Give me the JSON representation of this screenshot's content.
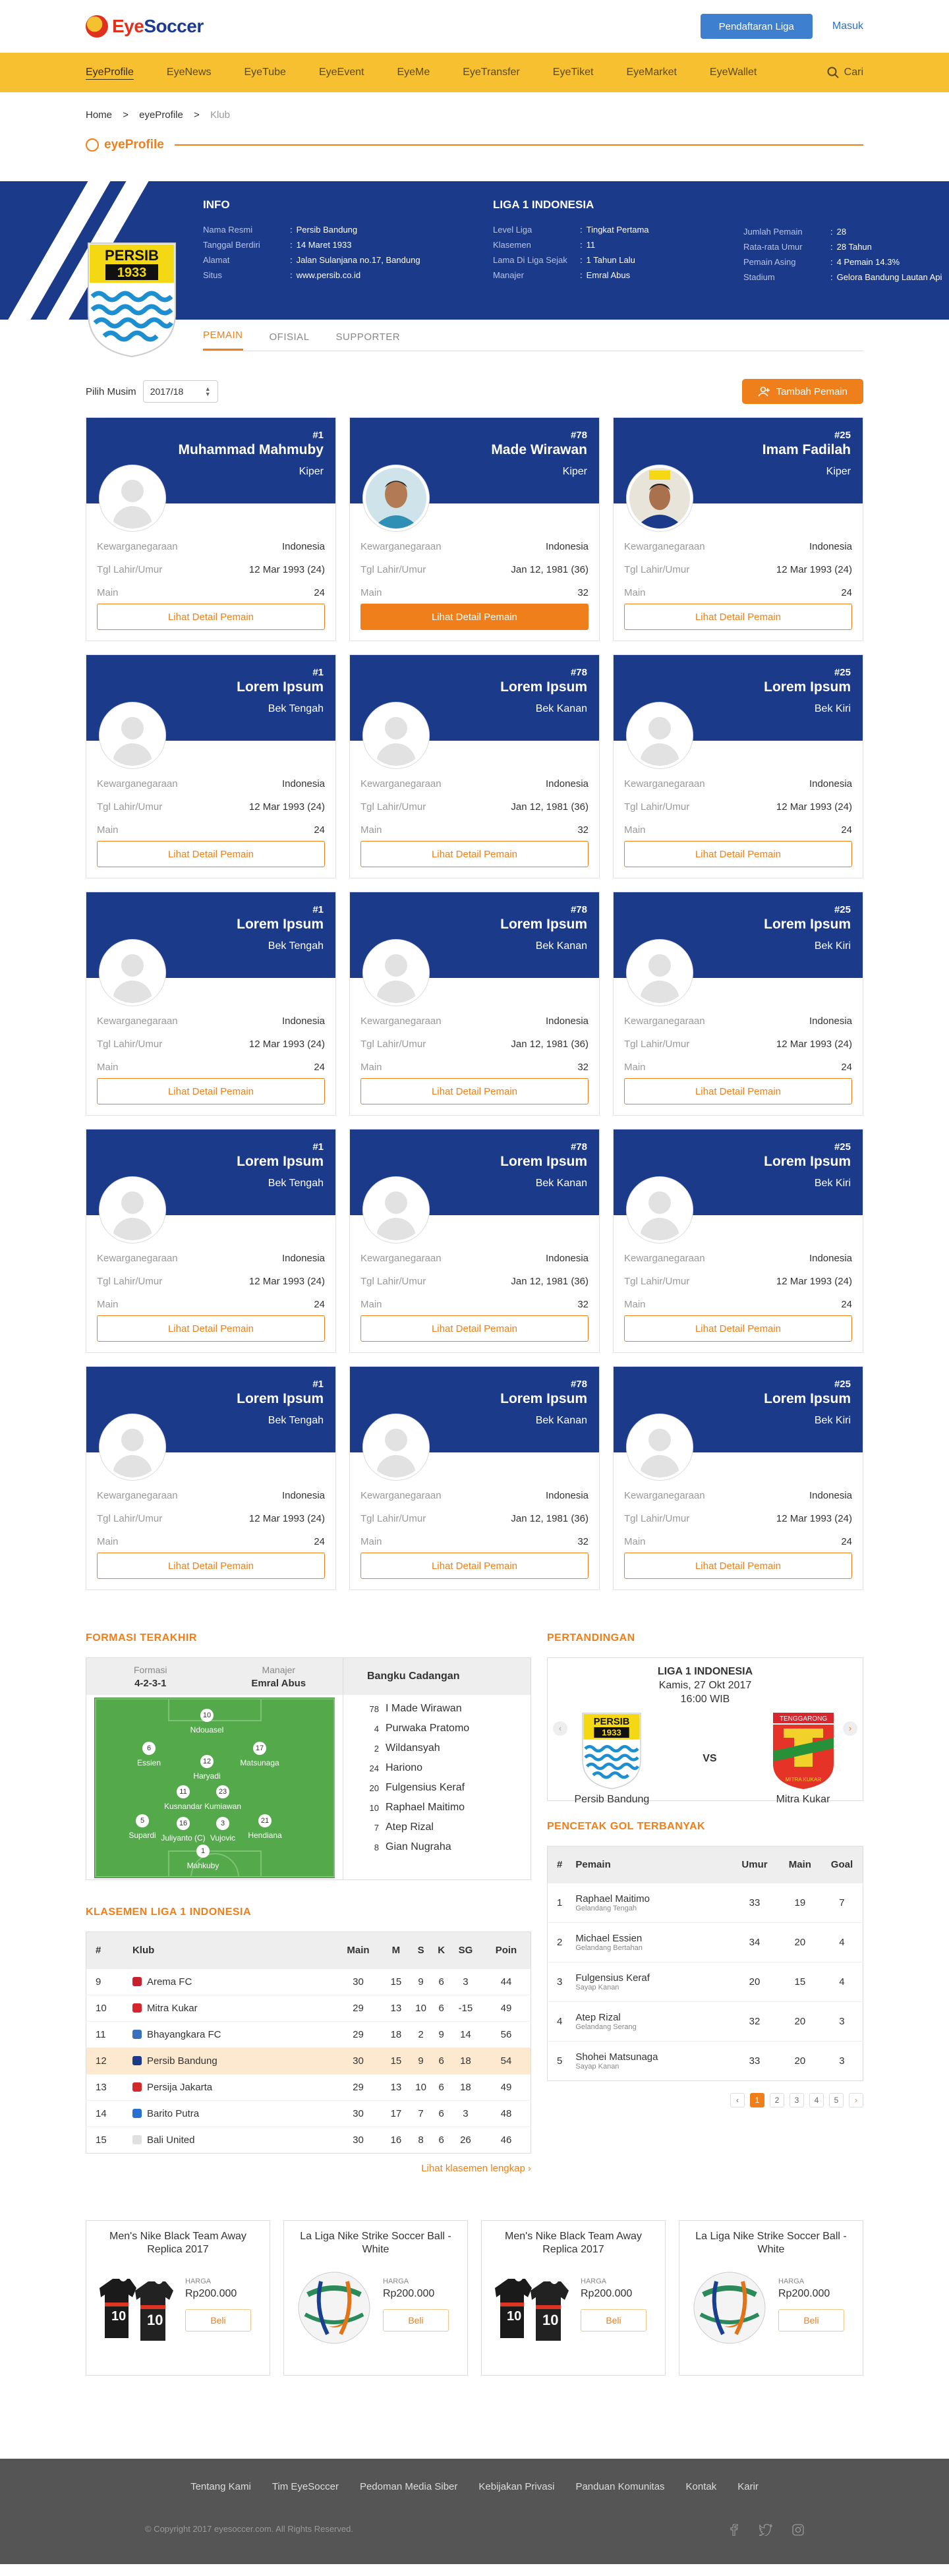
{
  "header": {
    "logo": "EyeSoccer",
    "register": "Pendaftaran Liga",
    "login": "Masuk"
  },
  "nav": {
    "items": [
      "EyeProfile",
      "EyeNews",
      "EyeTube",
      "EyeEvent",
      "EyeMe",
      "EyeTransfer",
      "EyeTiket",
      "EyeMarket",
      "EyeWallet"
    ],
    "search": "Cari"
  },
  "breadcrumb": [
    "Home",
    ">",
    "eyeProfile",
    ">",
    "Klub"
  ],
  "section_title": "eyeProfile",
  "club": {
    "info_title": "INFO",
    "info": [
      {
        "k": "Nama Resmi",
        "v": "Persib Bandung"
      },
      {
        "k": "Tanggal Berdiri",
        "v": "14 Maret 1933"
      },
      {
        "k": "Alamat",
        "v": "Jalan Sulanjana no.17, Bandung"
      },
      {
        "k": "Situs",
        "v": "www.persib.co.id"
      }
    ],
    "league_title": "LIGA 1 INDONESIA",
    "league": [
      {
        "k": "Level Liga",
        "v": "Tingkat Pertama"
      },
      {
        "k": "Klasemen",
        "v": "11"
      },
      {
        "k": "Lama Di Liga Sejak",
        "v": "1 Tahun Lalu"
      },
      {
        "k": "Manajer",
        "v": "Emral Abus"
      }
    ],
    "stats": [
      {
        "k": "Jumlah Pemain",
        "v": "28"
      },
      {
        "k": "Rata-rata Umur",
        "v": "28 Tahun"
      },
      {
        "k": "Pemain Asing",
        "v": "4 Pemain  14.3%"
      },
      {
        "k": "Stadium",
        "v": "Gelora Bandung Lautan Api"
      }
    ],
    "crest_text": [
      "PERSIB",
      "1933"
    ]
  },
  "tabs": [
    "PEMAIN",
    "OFISIAL",
    "SUPPORTER"
  ],
  "season_label": "Pilih Musim",
  "season_value": "2017/18",
  "add_player": "Tambah Pemain",
  "player_labels": {
    "nat": "Kewarganegaraan",
    "dob": "Tgl Lahir/Umur",
    "played": "Main",
    "button": "Lihat Detail Pemain"
  },
  "players": [
    {
      "num": "#1",
      "name": "Muhammad Mahmuby",
      "pos": "Kiper",
      "nat": "Indonesia",
      "dob": "12 Mar 1993 (24)",
      "played": "24",
      "photo": "none"
    },
    {
      "num": "#78",
      "name": "Made Wirawan",
      "pos": "Kiper",
      "nat": "Indonesia",
      "dob": "Jan 12, 1981 (36)",
      "played": "32",
      "photo": "wirawan"
    },
    {
      "num": "#25",
      "name": "Imam Fadilah",
      "pos": "Kiper",
      "nat": "Indonesia",
      "dob": "12 Mar 1993 (24)",
      "played": "24",
      "photo": "fadilah"
    },
    {
      "num": "#1",
      "name": "Lorem Ipsum",
      "pos": "Bek Tengah",
      "nat": "Indonesia",
      "dob": "12 Mar 1993 (24)",
      "played": "24"
    },
    {
      "num": "#78",
      "name": "Lorem Ipsum",
      "pos": "Bek Kanan",
      "nat": "Indonesia",
      "dob": "Jan 12, 1981 (36)",
      "played": "32"
    },
    {
      "num": "#25",
      "name": "Lorem Ipsum",
      "pos": "Bek Kiri",
      "nat": "Indonesia",
      "dob": "12 Mar 1993 (24)",
      "played": "24"
    },
    {
      "num": "#1",
      "name": "Lorem Ipsum",
      "pos": "Bek Tengah",
      "nat": "Indonesia",
      "dob": "12 Mar 1993 (24)",
      "played": "24"
    },
    {
      "num": "#78",
      "name": "Lorem Ipsum",
      "pos": "Bek Kanan",
      "nat": "Indonesia",
      "dob": "Jan 12, 1981 (36)",
      "played": "32"
    },
    {
      "num": "#25",
      "name": "Lorem Ipsum",
      "pos": "Bek Kiri",
      "nat": "Indonesia",
      "dob": "12 Mar 1993 (24)",
      "played": "24"
    },
    {
      "num": "#1",
      "name": "Lorem Ipsum",
      "pos": "Bek Tengah",
      "nat": "Indonesia",
      "dob": "12 Mar 1993 (24)",
      "played": "24"
    },
    {
      "num": "#78",
      "name": "Lorem Ipsum",
      "pos": "Bek Kanan",
      "nat": "Indonesia",
      "dob": "Jan 12, 1981 (36)",
      "played": "32"
    },
    {
      "num": "#25",
      "name": "Lorem Ipsum",
      "pos": "Bek Kiri",
      "nat": "Indonesia",
      "dob": "12 Mar 1993 (24)",
      "played": "24"
    },
    {
      "num": "#1",
      "name": "Lorem Ipsum",
      "pos": "Bek Tengah",
      "nat": "Indonesia",
      "dob": "12 Mar 1993 (24)",
      "played": "24"
    },
    {
      "num": "#78",
      "name": "Lorem Ipsum",
      "pos": "Bek Kanan",
      "nat": "Indonesia",
      "dob": "Jan 12, 1981 (36)",
      "played": "32"
    },
    {
      "num": "#25",
      "name": "Lorem Ipsum",
      "pos": "Bek Kiri",
      "nat": "Indonesia",
      "dob": "12 Mar 1993 (24)",
      "played": "24"
    }
  ],
  "formation": {
    "title": "FORMASI TERAKHIR",
    "formation_label": "Formasi",
    "formation_value": "4-2-3-1",
    "manager_label": "Manajer",
    "manager_value": "Emral Abus",
    "bench_title": "Bangku Cadangan",
    "bench": [
      {
        "n": "78",
        "name": "I Made Wirawan"
      },
      {
        "n": "4",
        "name": "Purwaka Pratomo"
      },
      {
        "n": "2",
        "name": "Wildansyah"
      },
      {
        "n": "24",
        "name": "Hariono"
      },
      {
        "n": "20",
        "name": "Fulgensius Keraf"
      },
      {
        "n": "10",
        "name": "Raphael Maitimo"
      },
      {
        "n": "7",
        "name": "Atep Rizal"
      },
      {
        "n": "8",
        "name": "Gian Nugraha"
      }
    ],
    "players": [
      {
        "n": "10",
        "name": "Ndouasel"
      },
      {
        "n": "6",
        "name": "Essien"
      },
      {
        "n": "17",
        "name": "Matsunaga"
      },
      {
        "n": "12",
        "name": "Haryadi"
      },
      {
        "n": "11",
        "name": "Kusnandar"
      },
      {
        "n": "23",
        "name": "Kumiawan"
      },
      {
        "n": "5",
        "name": "Supardi"
      },
      {
        "n": "16",
        "name": "Juliyanto (C)"
      },
      {
        "n": "3",
        "name": "Vujovic"
      },
      {
        "n": "21",
        "name": "Hendiana"
      },
      {
        "n": "1",
        "name": "Mahkuby"
      }
    ]
  },
  "standings": {
    "title": "KLASEMEN LIGA 1 INDONESIA",
    "headers": [
      "#",
      "Klub",
      "Main",
      "M",
      "S",
      "K",
      "SG",
      "Poin"
    ],
    "rows": [
      [
        "9",
        "Arema FC",
        "30",
        "15",
        "9",
        "6",
        "3",
        "44"
      ],
      [
        "10",
        "Mitra Kukar",
        "29",
        "13",
        "10",
        "6",
        "-15",
        "49"
      ],
      [
        "11",
        "Bhayangkara FC",
        "29",
        "18",
        "2",
        "9",
        "14",
        "56"
      ],
      [
        "12",
        "Persib Bandung",
        "30",
        "15",
        "9",
        "6",
        "18",
        "54"
      ],
      [
        "13",
        "Persija Jakarta",
        "29",
        "13",
        "10",
        "6",
        "18",
        "49"
      ],
      [
        "14",
        "Barito Putra",
        "30",
        "17",
        "7",
        "6",
        "3",
        "48"
      ],
      [
        "15",
        "Bali United",
        "30",
        "16",
        "8",
        "6",
        "26",
        "46"
      ]
    ],
    "highlight_row": 3,
    "more": "Lihat klasemen lengkap"
  },
  "match": {
    "title": "PERTANDINGAN",
    "league": "LIGA 1 INDONESIA",
    "date": "Kamis, 27 Okt 2017",
    "time": "16:00 WIB",
    "home": "Persib Bandung",
    "away": "Mitra Kukar",
    "vs": "VS",
    "away_crest_text": [
      "TENGGARONG",
      "MITRA KUKAR"
    ]
  },
  "scorers": {
    "title": "PENCETAK GOL TERBANYAK",
    "headers": [
      "#",
      "Pemain",
      "Umur",
      "Main",
      "Goal"
    ],
    "rows": [
      {
        "r": "1",
        "name": "Raphael Maitimo",
        "pos": "Gelandang Tengah",
        "age": "33",
        "played": "19",
        "goal": "7"
      },
      {
        "r": "2",
        "name": "Michael Essien",
        "pos": "Gelandang Bertahan",
        "age": "34",
        "played": "20",
        "goal": "4"
      },
      {
        "r": "3",
        "name": "Fulgensius Keraf",
        "pos": "Sayap Kanan",
        "age": "20",
        "played": "15",
        "goal": "4"
      },
      {
        "r": "4",
        "name": "Atep Rizal",
        "pos": "Gelandang Serang",
        "age": "32",
        "played": "20",
        "goal": "3"
      },
      {
        "r": "5",
        "name": "Shohei Matsunaga",
        "pos": "Sayap Kanan",
        "age": "33",
        "played": "20",
        "goal": "3"
      }
    ],
    "pages": [
      "‹",
      "1",
      "2",
      "3",
      "4",
      "5",
      "›"
    ]
  },
  "products": [
    {
      "title": "Men's Nike Black Team Away Replica 2017",
      "price_label": "HARGA",
      "price": "Rp200.000",
      "buy": "Beli",
      "img": "jersey",
      "jersey_text": "10"
    },
    {
      "title": "La Liga Nike Strike Soccer Ball - White",
      "price_label": "HARGA",
      "price": "Rp200.000",
      "buy": "Beli",
      "img": "ball"
    },
    {
      "title": "Men's Nike Black Team Away Replica 2017",
      "price_label": "HARGA",
      "price": "Rp200.000",
      "buy": "Beli",
      "img": "jersey",
      "jersey_text": "10"
    },
    {
      "title": "La Liga Nike Strike Soccer Ball - White",
      "price_label": "HARGA",
      "price": "Rp200.000",
      "buy": "Beli",
      "img": "ball"
    }
  ],
  "footer": {
    "links": [
      "Tentang Kami",
      "Tim EyeSoccer",
      "Pedoman Media Siber",
      "Kebijakan Privasi",
      "Panduan Komunitas",
      "Kontak",
      "Karir"
    ],
    "copyright": "© Copyright 2017 eyesoccer.com. All Rights Reserved.",
    "social": [
      "facebook-icon",
      "twitter-icon",
      "instagram-icon"
    ]
  },
  "colors": {
    "navy": "#1c3a8a",
    "orange": "#ef7f1a",
    "yellow": "#f7c030",
    "blue_button": "#3f7fd0"
  }
}
